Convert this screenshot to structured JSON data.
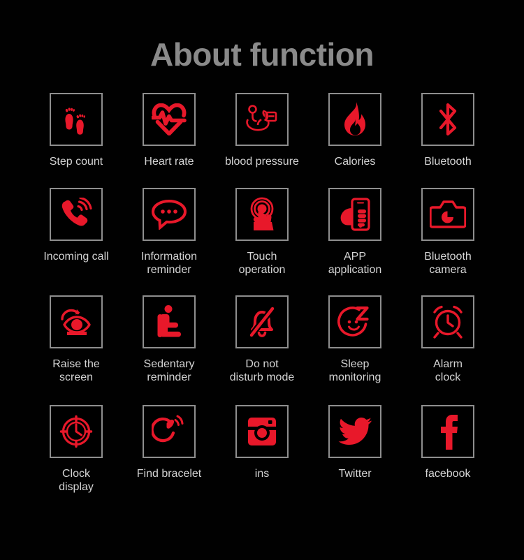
{
  "page": {
    "title": "About function",
    "background_color": "#000000",
    "title_color": "#8a8a8a",
    "label_color": "#d4d4d4",
    "icon_color": "#e8182a",
    "box_border_color": "#8e8e8e"
  },
  "rows": [
    {
      "items": [
        {
          "label": "Step count",
          "icon": "footprints-icon"
        },
        {
          "label": "Heart rate",
          "icon": "heart-pulse-icon"
        },
        {
          "label": "blood pressure",
          "icon": "blood-pressure-monitor-icon"
        },
        {
          "label": "Calories",
          "icon": "flame-icon"
        },
        {
          "label": "Bluetooth",
          "icon": "bluetooth-icon"
        }
      ]
    },
    {
      "items": [
        {
          "label": "Incoming call",
          "icon": "phone-ringing-icon"
        },
        {
          "label": "Information\nreminder",
          "icon": "speech-bubble-icon"
        },
        {
          "label": "Touch\noperation",
          "icon": "touch-hand-icon"
        },
        {
          "label": "APP\napplication",
          "icon": "hand-holding-phone-icon"
        },
        {
          "label": "Bluetooth\ncamera",
          "icon": "camera-icon"
        }
      ]
    },
    {
      "items": [
        {
          "label": "Raise the\nscreen",
          "icon": "raise-wrist-eye-icon"
        },
        {
          "label": "Sedentary\nreminder",
          "icon": "sitting-person-icon"
        },
        {
          "label": "Do not\ndisturb mode",
          "icon": "bell-slash-icon"
        },
        {
          "label": "Sleep\nmonitoring",
          "icon": "sleep-face-z-icon"
        },
        {
          "label": "Alarm\nclock",
          "icon": "alarm-clock-icon"
        }
      ]
    },
    {
      "items": [
        {
          "label": "Clock\ndisplay",
          "icon": "clock-dial-icon"
        },
        {
          "label": "Find bracelet",
          "icon": "find-bracelet-icon"
        },
        {
          "label": "ins",
          "icon": "instagram-icon"
        },
        {
          "label": "Twitter",
          "icon": "twitter-bird-icon"
        },
        {
          "label": "facebook",
          "icon": "facebook-f-icon"
        }
      ]
    }
  ]
}
